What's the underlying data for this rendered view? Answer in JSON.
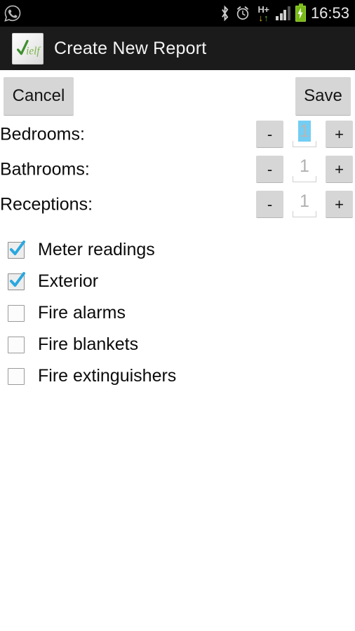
{
  "status_bar": {
    "notification_icon": "whatsapp-icon",
    "icons": [
      "bluetooth-icon",
      "alarm-icon",
      "hplus-data-icon",
      "signal-icon",
      "battery-charging-icon"
    ],
    "hplus_label": "H+",
    "arrow_down": "↓",
    "arrow_up": "↑",
    "signal_bars_filled": 3,
    "signal_bars_total": 4,
    "battery_charging": true,
    "time": "16:53",
    "background": "#000000"
  },
  "action_bar": {
    "logo_icon": "app-logo-ielf",
    "logo_text": "ielf",
    "title": "Create New Report",
    "background": "#1b1b1b"
  },
  "toolbar": {
    "cancel_label": "Cancel",
    "save_label": "Save"
  },
  "fields": [
    {
      "label": "Bedrooms:",
      "value": "1",
      "selected": true,
      "decrement_label": "-",
      "increment_label": "+"
    },
    {
      "label": "Bathrooms:",
      "value": "1",
      "selected": false,
      "decrement_label": "-",
      "increment_label": "+"
    },
    {
      "label": "Receptions:",
      "value": "1",
      "selected": false,
      "decrement_label": "-",
      "increment_label": "+"
    }
  ],
  "checkboxes": [
    {
      "label": "Meter readings",
      "checked": true
    },
    {
      "label": "Exterior",
      "checked": true
    },
    {
      "label": "Fire alarms",
      "checked": false
    },
    {
      "label": "Fire blankets",
      "checked": false
    },
    {
      "label": "Fire extinguishers",
      "checked": false
    }
  ],
  "colors": {
    "accent_blue": "#29a8df",
    "selection_blue": "#74cdf2",
    "button_gray": "#d6d6d6",
    "battery_green": "#78b917",
    "arrow_down_yellow": "#e8b612",
    "arrow_up_green": "#61bb2a"
  }
}
